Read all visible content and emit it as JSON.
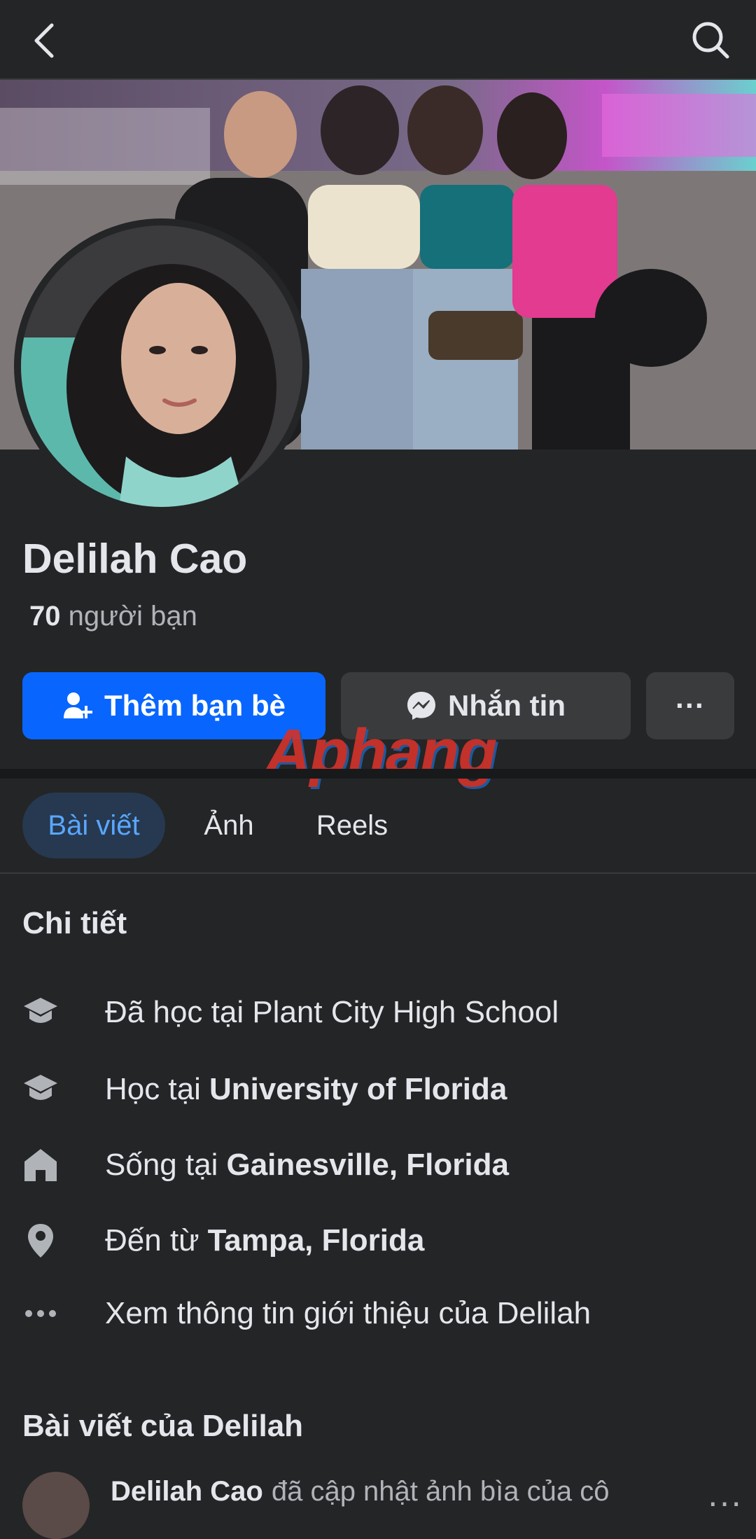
{
  "header": {
    "back_icon": "chevron-left-icon",
    "search_icon": "search-icon"
  },
  "profile": {
    "name": "Delilah Cao",
    "friends_count": "70",
    "friends_label": "người bạn"
  },
  "actions": {
    "add_friend": "Thêm bạn bè",
    "message": "Nhắn tin",
    "more": "···"
  },
  "watermark": "Aphang",
  "tabs": [
    {
      "label": "Bài viết",
      "active": true
    },
    {
      "label": "Ảnh",
      "active": false
    },
    {
      "label": "Reels",
      "active": false
    }
  ],
  "details": {
    "title": "Chi tiết",
    "items": [
      {
        "icon": "graduation-cap-icon",
        "text": "Đã học tại Plant City High School",
        "bold": ""
      },
      {
        "icon": "graduation-cap-icon",
        "text": "Học tại",
        "bold": "University of Florida"
      },
      {
        "icon": "home-icon",
        "text": "Sống tại",
        "bold": "Gainesville, Florida"
      },
      {
        "icon": "location-pin-icon",
        "text": "Đến từ",
        "bold": "Tampa, Florida"
      },
      {
        "icon": "more-dots-icon",
        "text": "Xem thông tin giới thiệu của Delilah",
        "bold": ""
      }
    ]
  },
  "posts": {
    "title": "Bài viết của Delilah",
    "first_author": "Delilah Cao",
    "first_action": "đã cập nhật ảnh bìa của cô"
  },
  "colors": {
    "background": "#242526",
    "primary_button": "#0866ff",
    "secondary_button": "#3a3b3c",
    "active_tab_bg": "#263951",
    "active_tab_text": "#5aa7ff"
  }
}
